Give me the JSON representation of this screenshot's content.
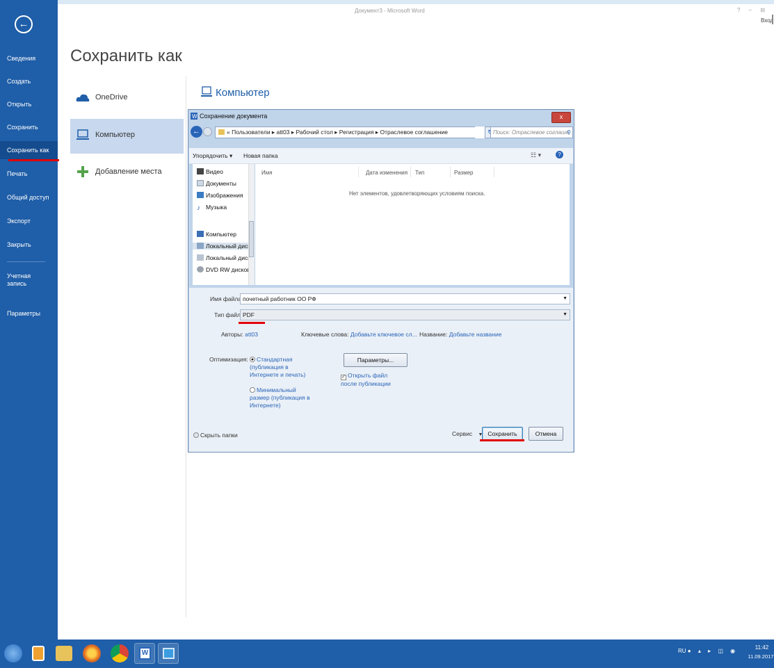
{
  "window": {
    "title": "Документ3 - Microsoft Word",
    "controls": "? – ⊟",
    "signin": "Вход"
  },
  "sidebar": {
    "items": [
      {
        "label": "Сведения"
      },
      {
        "label": "Создать"
      },
      {
        "label": "Открыть"
      },
      {
        "label": "Сохранить"
      },
      {
        "label": "Сохранить как",
        "active": true
      },
      {
        "label": "Печать"
      },
      {
        "label": "Общий доступ"
      },
      {
        "label": "Экспорт"
      },
      {
        "label": "Закрыть"
      },
      {
        "label": "Учетная запись"
      },
      {
        "label": "Параметры"
      }
    ]
  },
  "page": {
    "title": "Сохранить как",
    "places": [
      {
        "label": "OneDrive",
        "icon": "cloud-icon"
      },
      {
        "label": "Компьютер",
        "icon": "computer-icon",
        "active": true
      },
      {
        "label": "Добавление места",
        "icon": "plus-icon"
      }
    ],
    "computer_heading": "Компьютер"
  },
  "dialog": {
    "title": "Сохранение документа",
    "close": "x",
    "address": "« Пользователи ▸ att03 ▸ Рабочий стол ▸ Регистрация ▸ Отраслевое соглашение",
    "search_placeholder": "Поиск: Отраслевое соглаше...",
    "toolbar": {
      "organize": "Упорядочить ▾",
      "new_folder": "Новая папка",
      "view": "☷ ▾",
      "help": "?"
    },
    "nav": [
      {
        "label": "Видео"
      },
      {
        "label": "Документы"
      },
      {
        "label": "Изображения"
      },
      {
        "label": "Музыка"
      },
      {
        "label": "Компьютер"
      },
      {
        "label": "Локальный диск"
      },
      {
        "label": "Локальный диск"
      },
      {
        "label": "DVD RW дисковод"
      }
    ],
    "columns": [
      "Имя",
      "Дата изменения",
      "Тип",
      "Размер"
    ],
    "empty_message": "Нет элементов, удовлетворяющих условиям поиска.",
    "filename_label": "Имя файла:",
    "filename_value": "почетный работник ОО РФ",
    "filetype_label": "Тип файла:",
    "filetype_value": "PDF",
    "authors_label": "Авторы:",
    "authors_value": "att03",
    "keywords_label": "Ключевые слова:",
    "keywords_value": "Добавьте ключевое сл...",
    "name_label": "Название:",
    "name_value": "Добавьте название",
    "optimize_label": "Оптимизация:",
    "opt_standard": "Стандартная (публикация в Интернете и печать)",
    "opt_minimal": "Минимальный размер (публикация в Интернете)",
    "params_button": "Параметры...",
    "open_after": "Открыть файл после публикации",
    "hide_folders": "Скрыть папки",
    "service": "Сервис",
    "save": "Сохранить",
    "cancel": "Отмена"
  },
  "taskbar": {
    "tray": "RU",
    "time": "11:42",
    "date": "11.09.2017"
  },
  "colors": {
    "brand": "#1f5ea8",
    "highlight": "#e00000"
  }
}
